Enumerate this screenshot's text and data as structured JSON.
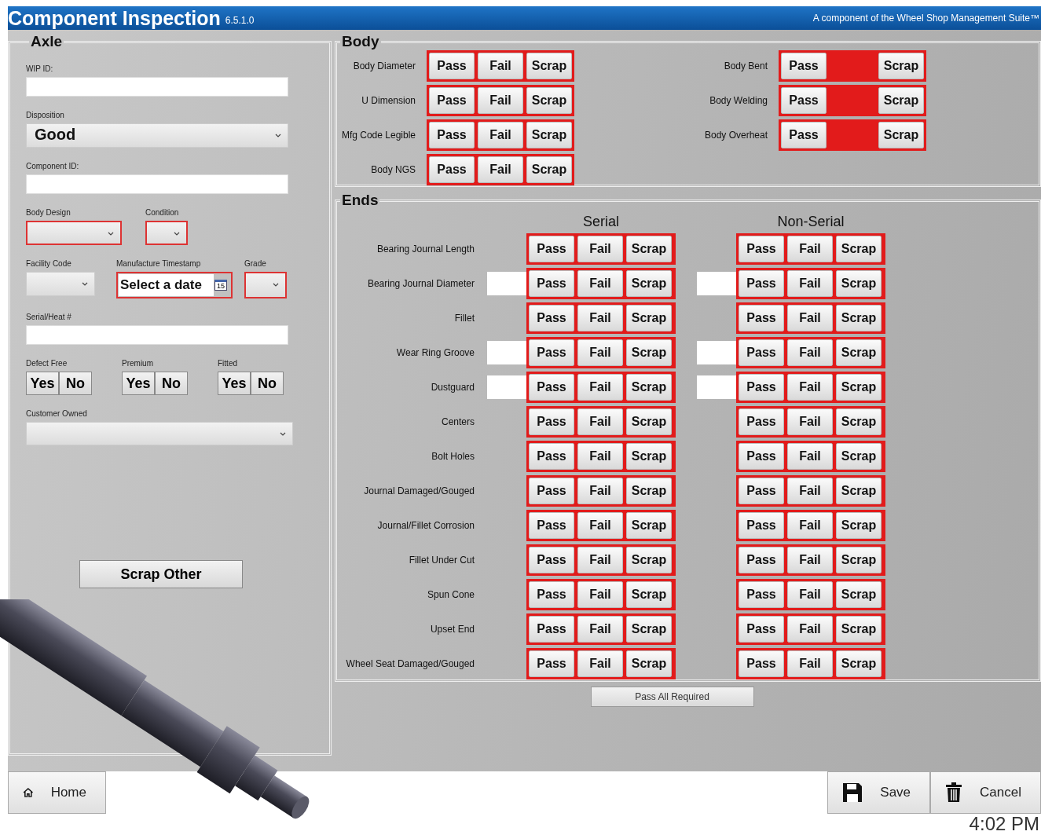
{
  "window": {
    "title": "Component Inspection",
    "version": "6.5.1.0",
    "subtitle": "A component of the Wheel Shop Management Suite™"
  },
  "axle": {
    "title": "Axle",
    "fields": [
      {
        "kind": "text",
        "label": "WIP ID:"
      },
      {
        "kind": "select",
        "label": "Disposition",
        "value": "Good"
      },
      {
        "kind": "text",
        "label": "Component ID:"
      }
    ],
    "selects_row": [
      {
        "label": "Body Design",
        "required": true
      },
      {
        "label": "Condition",
        "required": true
      }
    ],
    "facility": {
      "label": "Facility Code",
      "required": false
    },
    "timestamp": {
      "label": "Manufacture Timestamp",
      "placeholder": "Select a date",
      "icon_text": "15",
      "required": true
    },
    "grade": {
      "label": "Grade",
      "required": true
    },
    "serial": {
      "label": "Serial/Heat #"
    },
    "toggles": [
      {
        "label": "Defect Free",
        "options": [
          "Yes",
          "No"
        ]
      },
      {
        "label": "Premium",
        "options": [
          "Yes",
          "No"
        ]
      },
      {
        "label": "Fitted",
        "options": [
          "Yes",
          "No"
        ]
      }
    ],
    "customer_owned": {
      "label": "Customer Owned"
    },
    "scrap_button": "Scrap Other"
  },
  "body": {
    "title": "Body",
    "left_rows": [
      {
        "label": "Body Diameter",
        "buttons": [
          {
            "kind": "button",
            "text": "Pass"
          },
          {
            "kind": "button",
            "text": "Fail"
          },
          {
            "kind": "button",
            "text": "Scrap"
          }
        ]
      },
      {
        "label": "U Dimension",
        "buttons": [
          {
            "kind": "button",
            "text": "Pass"
          },
          {
            "kind": "button",
            "text": "Fail"
          },
          {
            "kind": "button",
            "text": "Scrap"
          }
        ]
      },
      {
        "label": "Mfg Code Legible",
        "buttons": [
          {
            "kind": "button",
            "text": "Pass"
          },
          {
            "kind": "button",
            "text": "Fail"
          },
          {
            "kind": "button",
            "text": "Scrap"
          }
        ]
      },
      {
        "label": "Body NGS",
        "buttons": [
          {
            "kind": "button",
            "text": "Pass"
          },
          {
            "kind": "button",
            "text": "Fail"
          },
          {
            "kind": "button",
            "text": "Scrap"
          }
        ]
      }
    ],
    "right_rows": [
      {
        "label": "Body Bent",
        "buttons": [
          {
            "kind": "button",
            "text": "Pass"
          },
          {
            "kind": "gap"
          },
          {
            "kind": "button",
            "text": "Scrap"
          }
        ]
      },
      {
        "label": "Body Welding",
        "buttons": [
          {
            "kind": "button",
            "text": "Pass"
          },
          {
            "kind": "gap"
          },
          {
            "kind": "button",
            "text": "Scrap"
          }
        ]
      },
      {
        "label": "Body Overheat",
        "buttons": [
          {
            "kind": "button",
            "text": "Pass"
          },
          {
            "kind": "gap"
          },
          {
            "kind": "button",
            "text": "Scrap"
          }
        ]
      }
    ]
  },
  "ends": {
    "title": "Ends",
    "headers": [
      "Serial",
      "Non-Serial"
    ],
    "rows": [
      {
        "label": "Bearing Journal Length",
        "serial": {
          "field": false,
          "buttons": [
            "Pass",
            "Fail",
            "Scrap"
          ]
        },
        "non_serial": {
          "field": false,
          "buttons": [
            "Pass",
            "Fail",
            "Scrap"
          ]
        }
      },
      {
        "label": "Bearing Journal Diameter",
        "serial": {
          "field": true,
          "buttons": [
            "Pass",
            "Fail",
            "Scrap"
          ]
        },
        "non_serial": {
          "field": true,
          "buttons": [
            "Pass",
            "Fail",
            "Scrap"
          ]
        }
      },
      {
        "label": "Fillet",
        "serial": {
          "field": false,
          "buttons": [
            "Pass",
            "Fail",
            "Scrap"
          ]
        },
        "non_serial": {
          "field": false,
          "buttons": [
            "Pass",
            "Fail",
            "Scrap"
          ]
        }
      },
      {
        "label": "Wear Ring Groove",
        "serial": {
          "field": true,
          "buttons": [
            "Pass",
            "Fail",
            "Scrap"
          ]
        },
        "non_serial": {
          "field": true,
          "buttons": [
            "Pass",
            "Fail",
            "Scrap"
          ]
        }
      },
      {
        "label": "Dustguard",
        "serial": {
          "field": true,
          "buttons": [
            "Pass",
            "Fail",
            "Scrap"
          ]
        },
        "non_serial": {
          "field": true,
          "buttons": [
            "Pass",
            "Fail",
            "Scrap"
          ]
        }
      },
      {
        "label": "Centers",
        "serial": {
          "field": false,
          "buttons": [
            "Pass",
            "Fail",
            "Scrap"
          ]
        },
        "non_serial": {
          "field": false,
          "buttons": [
            "Pass",
            "Fail",
            "Scrap"
          ]
        }
      },
      {
        "label": "Bolt Holes",
        "serial": {
          "field": false,
          "buttons": [
            "Pass",
            "Fail",
            "Scrap"
          ]
        },
        "non_serial": {
          "field": false,
          "buttons": [
            "Pass",
            "Fail",
            "Scrap"
          ]
        }
      },
      {
        "label": "Journal Damaged/Gouged",
        "serial": {
          "field": false,
          "buttons": [
            "Pass",
            "Fail",
            "Scrap"
          ]
        },
        "non_serial": {
          "field": false,
          "buttons": [
            "Pass",
            "Fail",
            "Scrap"
          ]
        }
      },
      {
        "label": "Journal/Fillet Corrosion",
        "serial": {
          "field": false,
          "buttons": [
            "Pass",
            "Fail",
            "Scrap"
          ]
        },
        "non_serial": {
          "field": false,
          "buttons": [
            "Pass",
            "Fail",
            "Scrap"
          ]
        }
      },
      {
        "label": "Fillet Under Cut",
        "serial": {
          "field": false,
          "buttons": [
            "Pass",
            "Fail",
            "Scrap"
          ]
        },
        "non_serial": {
          "field": false,
          "buttons": [
            "Pass",
            "Fail",
            "Scrap"
          ]
        }
      },
      {
        "label": "Spun Cone",
        "serial": {
          "field": false,
          "buttons": [
            "Pass",
            "Fail",
            "Scrap"
          ]
        },
        "non_serial": {
          "field": false,
          "buttons": [
            "Pass",
            "Fail",
            "Scrap"
          ]
        }
      },
      {
        "label": "Upset End",
        "serial": {
          "field": false,
          "buttons": [
            "Pass",
            "Fail",
            "Scrap"
          ]
        },
        "non_serial": {
          "field": false,
          "buttons": [
            "Pass",
            "Fail",
            "Scrap"
          ]
        }
      },
      {
        "label": "Wheel Seat Damaged/Gouged",
        "serial": {
          "field": false,
          "buttons": [
            "Pass",
            "Fail",
            "Scrap"
          ]
        },
        "non_serial": {
          "field": false,
          "buttons": [
            "Pass",
            "Fail",
            "Scrap"
          ]
        }
      }
    ]
  },
  "pass_all_button": "Pass All Required",
  "footer": {
    "home": "Home",
    "save": "Save",
    "cancel": "Cancel",
    "time": "4:02 PM"
  }
}
